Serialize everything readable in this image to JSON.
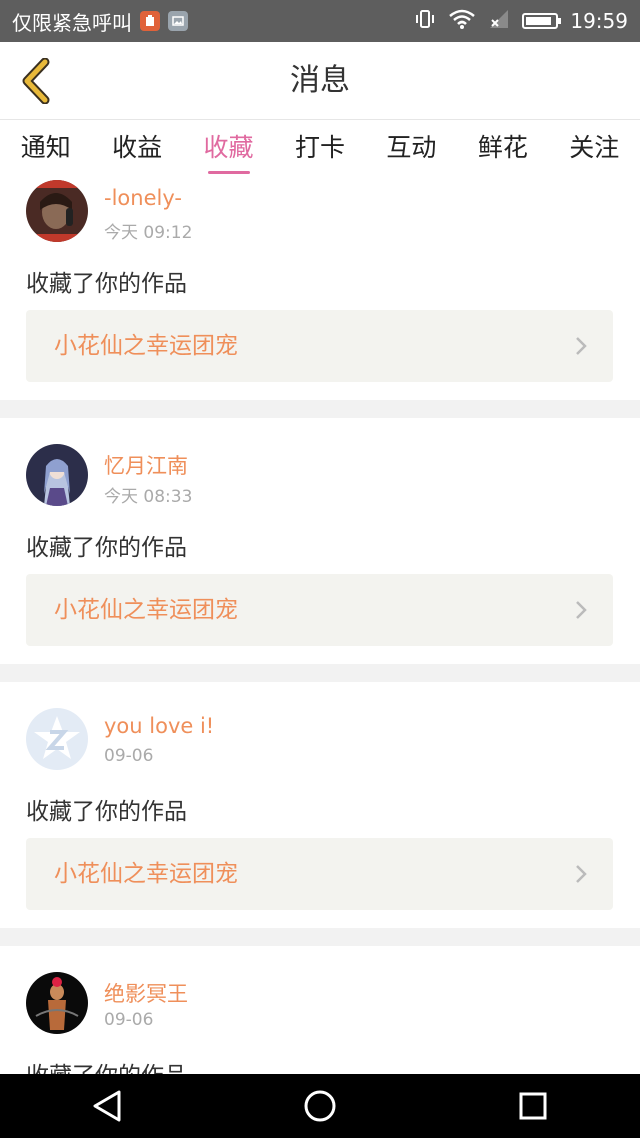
{
  "status_bar": {
    "notice": "仅限紧急呼叫",
    "time": "19:59",
    "battery_level": 0.9
  },
  "header": {
    "title": "消息",
    "back_icon": "chevron-left-icon"
  },
  "tabs": [
    {
      "label": "通知",
      "active": false
    },
    {
      "label": "收益",
      "active": false
    },
    {
      "label": "收藏",
      "active": true
    },
    {
      "label": "打卡",
      "active": false
    },
    {
      "label": "互动",
      "active": false
    },
    {
      "label": "鲜花",
      "active": false
    },
    {
      "label": "关注",
      "active": false
    }
  ],
  "messages": [
    {
      "username": "-lonely-",
      "time": "今天 09:12",
      "action": "收藏了你的作品",
      "work": "小花仙之幸运团宠"
    },
    {
      "username": "忆月江南",
      "time": "今天 08:33",
      "action": "收藏了你的作品",
      "work": "小花仙之幸运团宠"
    },
    {
      "username": "you love i!",
      "time": "09-06",
      "action": "收藏了你的作品",
      "work": "小花仙之幸运团宠"
    },
    {
      "username": "绝影冥王",
      "time": "09-06",
      "action": "收藏了你的作品"
    }
  ],
  "colors": {
    "accent": "#e06aa0",
    "username": "#ef8f5a",
    "link_bg": "#f3f3ef",
    "back_arrow": "#e8b93a"
  }
}
